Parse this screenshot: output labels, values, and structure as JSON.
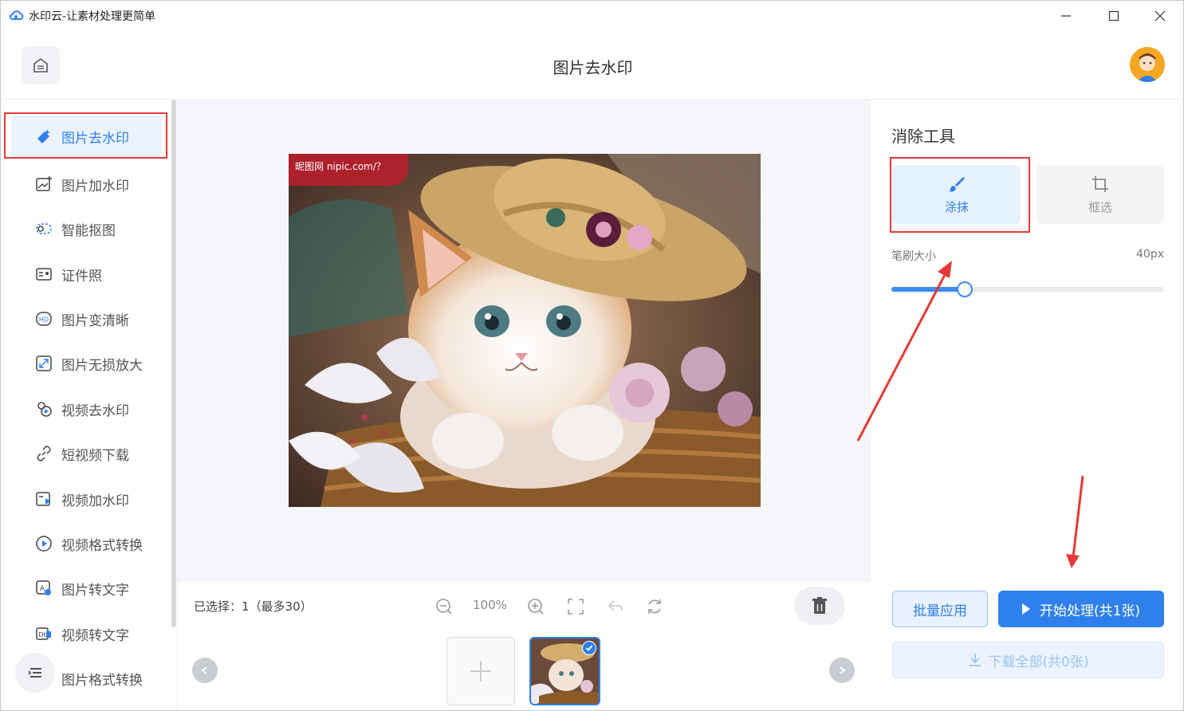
{
  "window": {
    "title": "水印云-让素材处理更简单",
    "logo_icon": "cloud-logo-icon",
    "controls": [
      "minimize",
      "maximize",
      "close"
    ]
  },
  "header": {
    "title": "图片去水印",
    "home_icon": "home-icon"
  },
  "sidebar": {
    "active_index": 0,
    "items": [
      {
        "label": "图片去水印",
        "icon": "eraser-icon"
      },
      {
        "label": "图片加水印",
        "icon": "image-add-icon"
      },
      {
        "label": "智能抠图",
        "icon": "cutout-icon"
      },
      {
        "label": "证件照",
        "icon": "id-card-icon"
      },
      {
        "label": "图片变清晰",
        "icon": "hd-icon"
      },
      {
        "label": "图片无损放大",
        "icon": "enlarge-icon"
      },
      {
        "label": "视频去水印",
        "icon": "video-eraser-icon"
      },
      {
        "label": "短视频下载",
        "icon": "link-icon"
      },
      {
        "label": "视频加水印",
        "icon": "video-add-icon"
      },
      {
        "label": "视频格式转换",
        "icon": "play-circle-icon"
      },
      {
        "label": "图片转文字",
        "icon": "image-text-icon"
      },
      {
        "label": "视频转文字",
        "icon": "video-text-icon"
      },
      {
        "label": "图片格式转换",
        "icon": "format-icon"
      }
    ]
  },
  "canvas": {
    "watermark_text": "昵图网 nipic.com/？",
    "accent": "#2f80ed"
  },
  "toolbar": {
    "selected_info": "已选择：1（最多30）",
    "zoom": "100%"
  },
  "panel": {
    "title": "消除工具",
    "tools": [
      {
        "label": "涂抹",
        "icon": "brush-icon",
        "active": true
      },
      {
        "label": "框选",
        "icon": "crop-icon",
        "active": false
      }
    ],
    "brush_label": "笔刷大小",
    "brush_value": "40px",
    "brush_fraction": 0.27,
    "batch_label": "批量应用",
    "start_label": "开始处理(共1张)",
    "download_label": "下载全部(共0张)"
  }
}
